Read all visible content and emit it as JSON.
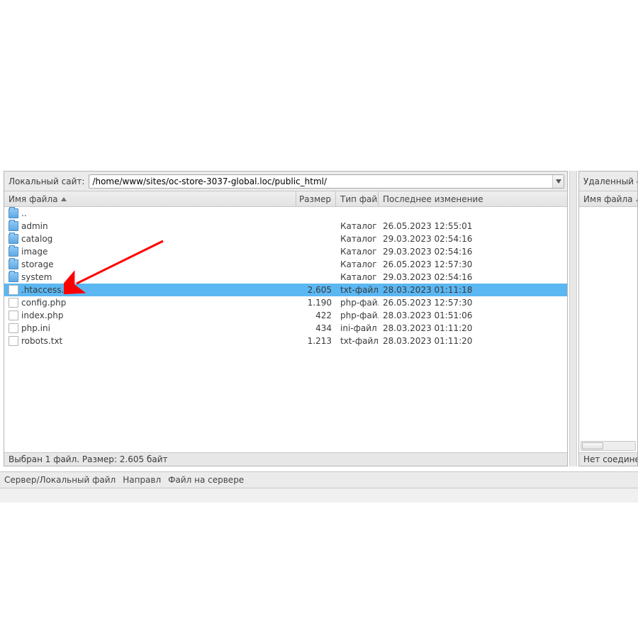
{
  "local": {
    "site_label": "Локальный сайт:",
    "path": "/home/www/sites/oc-store-3037-global.loc/public_html/",
    "columns": {
      "name": "Имя файла",
      "size": "Размер",
      "type": "Тип файла",
      "modified": "Последнее изменение"
    },
    "rows": [
      {
        "icon": "folder",
        "name": "..",
        "size": "",
        "type": "",
        "modified": "",
        "selected": false
      },
      {
        "icon": "folder",
        "name": "admin",
        "size": "",
        "type": "Каталог",
        "modified": "26.05.2023 12:55:01",
        "selected": false
      },
      {
        "icon": "folder",
        "name": "catalog",
        "size": "",
        "type": "Каталог",
        "modified": "29.03.2023 02:54:16",
        "selected": false
      },
      {
        "icon": "folder",
        "name": "image",
        "size": "",
        "type": "Каталог",
        "modified": "29.03.2023 02:54:16",
        "selected": false
      },
      {
        "icon": "folder",
        "name": "storage",
        "size": "",
        "type": "Каталог",
        "modified": "26.05.2023 12:57:30",
        "selected": false
      },
      {
        "icon": "folder",
        "name": "system",
        "size": "",
        "type": "Каталог",
        "modified": "29.03.2023 02:54:16",
        "selected": false
      },
      {
        "icon": "file",
        "name": ".htaccess.txt",
        "size": "2.605",
        "type": "txt-файл",
        "modified": "28.03.2023 01:11:18",
        "selected": true
      },
      {
        "icon": "file",
        "name": "config.php",
        "size": "1.190",
        "type": "php-файл",
        "modified": "26.05.2023 12:57:30",
        "selected": false
      },
      {
        "icon": "file",
        "name": "index.php",
        "size": "422",
        "type": "php-файл",
        "modified": "28.03.2023 01:51:06",
        "selected": false
      },
      {
        "icon": "file",
        "name": "php.ini",
        "size": "434",
        "type": "ini-файл",
        "modified": "28.03.2023 01:11:20",
        "selected": false
      },
      {
        "icon": "file",
        "name": "robots.txt",
        "size": "1.213",
        "type": "txt-файл",
        "modified": "28.03.2023 01:11:20",
        "selected": false
      }
    ],
    "status": "Выбран 1 файл. Размер: 2.605 байт"
  },
  "remote": {
    "site_label": "Удаленный са",
    "columns": {
      "name": "Имя файла"
    },
    "status": "Нет соединен"
  },
  "bottom": {
    "col1": "Сервер/Локальный файл",
    "col2": "Направл",
    "col3": "Файл на сервере"
  }
}
